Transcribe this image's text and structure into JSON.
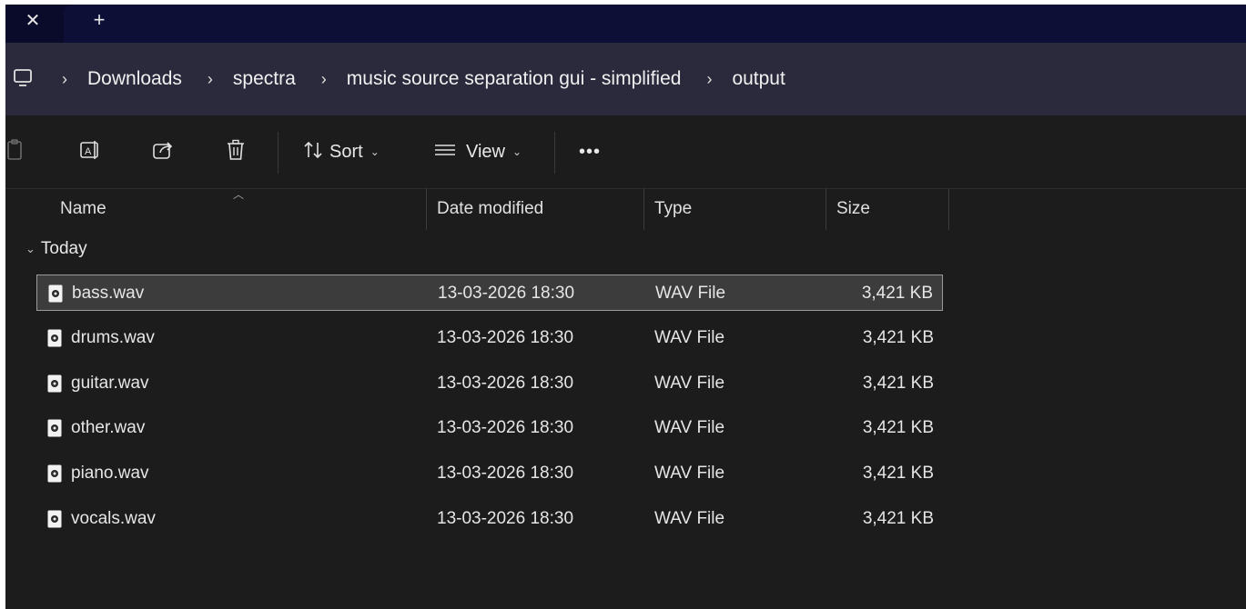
{
  "tabbar": {
    "close_label": "✕",
    "new_tab_label": "+"
  },
  "breadcrumb": {
    "items": [
      "Downloads",
      "spectra",
      "music source separation gui - simplified",
      "output"
    ],
    "separator": "›"
  },
  "toolbar": {
    "sort_label": "Sort",
    "view_label": "View",
    "more_label": "•••"
  },
  "columns": {
    "name": "Name",
    "date": "Date modified",
    "type": "Type",
    "size": "Size"
  },
  "group": {
    "label": "Today"
  },
  "files": [
    {
      "name": "bass.wav",
      "date": "13-03-2026 18:30",
      "type": "WAV File",
      "size": "3,421 KB",
      "selected": true
    },
    {
      "name": "drums.wav",
      "date": "13-03-2026 18:30",
      "type": "WAV File",
      "size": "3,421 KB",
      "selected": false
    },
    {
      "name": "guitar.wav",
      "date": "13-03-2026 18:30",
      "type": "WAV File",
      "size": "3,421 KB",
      "selected": false
    },
    {
      "name": "other.wav",
      "date": "13-03-2026 18:30",
      "type": "WAV File",
      "size": "3,421 KB",
      "selected": false
    },
    {
      "name": "piano.wav",
      "date": "13-03-2026 18:30",
      "type": "WAV File",
      "size": "3,421 KB",
      "selected": false
    },
    {
      "name": "vocals.wav",
      "date": "13-03-2026 18:30",
      "type": "WAV File",
      "size": "3,421 KB",
      "selected": false
    }
  ],
  "colors": {
    "background": "#1c1c1c",
    "tabbar": "#0d0f36",
    "addressbar": "#2b2a3d",
    "selection": "#3c3c3c",
    "text": "#e6e6e6"
  }
}
